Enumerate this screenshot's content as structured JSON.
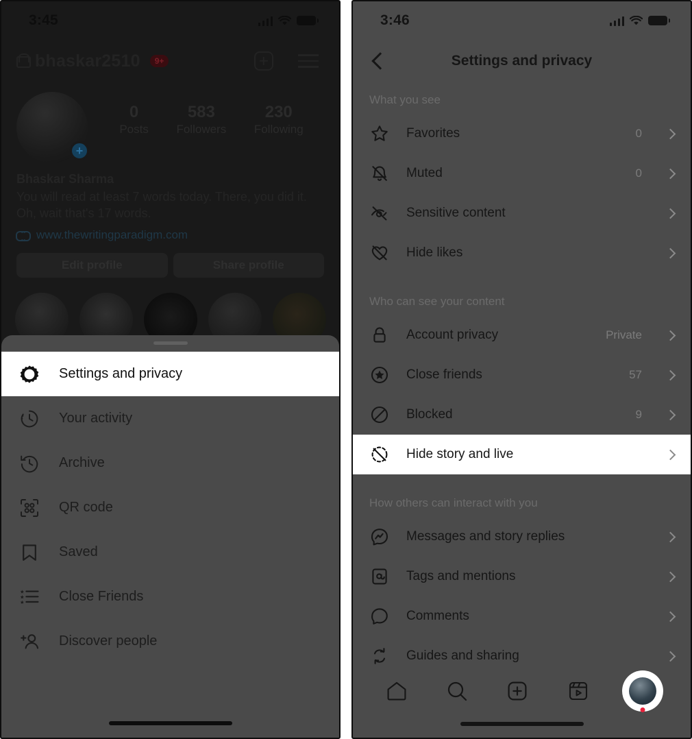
{
  "left_phone": {
    "status_bar": {
      "time": "3:45",
      "signal_icon": "cellular-signal-icon",
      "wifi_icon": "wifi-icon",
      "battery_icon": "battery-icon"
    },
    "header": {
      "lock_icon": "lock-icon",
      "username": "bhaskar2510",
      "badge": "9+",
      "new_post_icon": "plus-square-icon",
      "menu_icon": "hamburger-menu-icon"
    },
    "profile": {
      "avatar": "profile-avatar",
      "add_story_icon": "plus-circle-icon",
      "stats": [
        {
          "number": "0",
          "label": "Posts"
        },
        {
          "number": "583",
          "label": "Followers"
        },
        {
          "number": "230",
          "label": "Following"
        }
      ],
      "full_name": "Bhaskar Sharma",
      "bio": "You will read at least 7 words today. There, you did it. Oh, wait that's 17 words.",
      "link_icon": "link-icon",
      "link": "www.thewritingparadigm.com",
      "edit_button": "Edit profile",
      "share_button": "Share profile"
    },
    "sheet": {
      "items": [
        {
          "label": "Settings and privacy",
          "icon": "gear-icon",
          "highlighted": true
        },
        {
          "label": "Your activity",
          "icon": "activity-clock-icon",
          "highlighted": false
        },
        {
          "label": "Archive",
          "icon": "archive-clock-icon",
          "highlighted": false
        },
        {
          "label": "QR code",
          "icon": "qr-code-icon",
          "highlighted": false
        },
        {
          "label": "Saved",
          "icon": "bookmark-icon",
          "highlighted": false
        },
        {
          "label": "Close Friends",
          "icon": "close-friends-list-icon",
          "highlighted": false
        },
        {
          "label": "Discover people",
          "icon": "add-person-icon",
          "highlighted": false
        }
      ]
    }
  },
  "right_phone": {
    "status_bar": {
      "time": "3:46",
      "signal_icon": "cellular-signal-icon",
      "wifi_icon": "wifi-icon",
      "battery_icon": "battery-icon"
    },
    "nav": {
      "back_icon": "chevron-left-icon",
      "title": "Settings and privacy"
    },
    "sections": [
      {
        "heading": "What you see",
        "rows": [
          {
            "label": "Favorites",
            "value": "0",
            "icon": "star-icon",
            "highlighted": false
          },
          {
            "label": "Muted",
            "value": "0",
            "icon": "bell-muted-icon",
            "highlighted": false
          },
          {
            "label": "Sensitive content",
            "value": "",
            "icon": "eye-off-icon",
            "highlighted": false
          },
          {
            "label": "Hide likes",
            "value": "",
            "icon": "heart-off-icon",
            "highlighted": false
          }
        ]
      },
      {
        "heading": "Who can see your content",
        "rows": [
          {
            "label": "Account privacy",
            "value": "Private",
            "icon": "lock-icon",
            "highlighted": false
          },
          {
            "label": "Close friends",
            "value": "57",
            "icon": "star-circle-icon",
            "highlighted": false
          },
          {
            "label": "Blocked",
            "value": "9",
            "icon": "block-icon",
            "highlighted": false
          },
          {
            "label": "Hide story and live",
            "value": "",
            "icon": "hide-story-icon",
            "highlighted": true
          }
        ]
      },
      {
        "heading": "How others can interact with you",
        "rows": [
          {
            "label": "Messages and story replies",
            "value": "",
            "icon": "messenger-icon",
            "highlighted": false
          },
          {
            "label": "Tags and mentions",
            "value": "",
            "icon": "at-mention-icon",
            "highlighted": false
          },
          {
            "label": "Comments",
            "value": "",
            "icon": "comment-bubble-icon",
            "highlighted": false
          },
          {
            "label": "Guides and sharing",
            "value": "",
            "icon": "repeat-sharing-icon",
            "highlighted": false
          }
        ]
      }
    ],
    "tabbar": {
      "items": [
        {
          "icon": "home-icon",
          "name": "tab-home"
        },
        {
          "icon": "search-icon",
          "name": "tab-search"
        },
        {
          "icon": "plus-square-icon",
          "name": "tab-create"
        },
        {
          "icon": "reels-icon",
          "name": "tab-reels"
        },
        {
          "icon": "profile-avatar-icon",
          "name": "tab-profile"
        }
      ]
    }
  },
  "colors": {
    "highlight_bg": "#ffffff",
    "dim_overlay": "#4a4a4a",
    "dark_bg": "#191919",
    "badge_red": "#e8223c",
    "accent_blue": "#14405c"
  }
}
